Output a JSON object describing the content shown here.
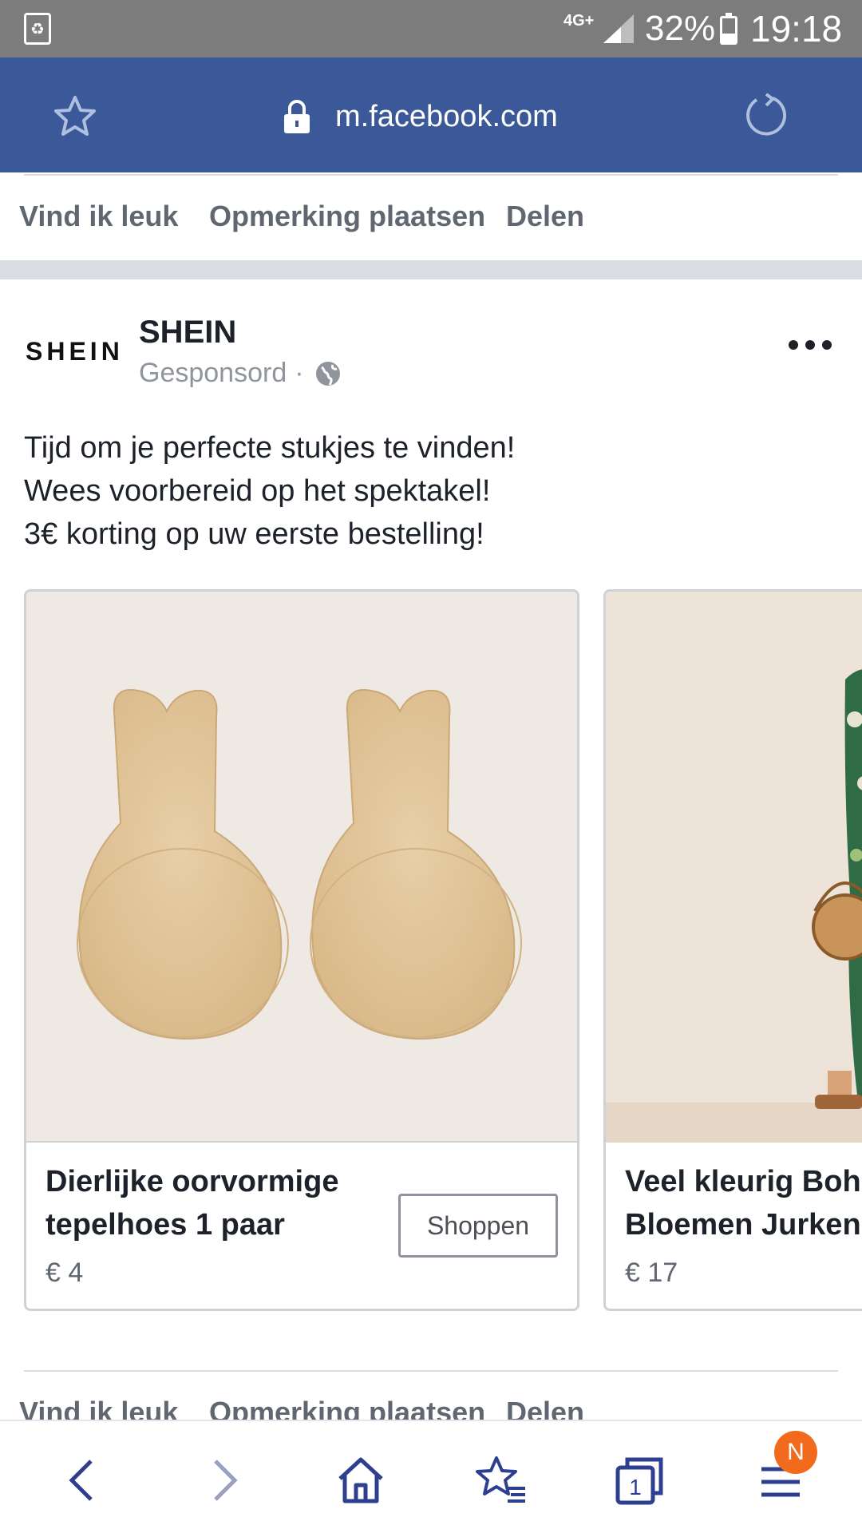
{
  "status_bar": {
    "network": "4G+",
    "battery_percent": "32%",
    "battery_level": 0.32,
    "time": "19:18",
    "icons": [
      "recycle-icon",
      "signal-icon",
      "battery-icon"
    ]
  },
  "browser": {
    "url": "m.facebook.com",
    "icons": [
      "star-icon",
      "lock-icon",
      "reload-icon"
    ]
  },
  "post_actions_top": {
    "like": "Vind ik leuk",
    "comment": "Opmerking plaatsen",
    "share": "Delen"
  },
  "post": {
    "brand_logo": "SHEIN",
    "page_name": "SHEIN",
    "sponsored": "Gesponsord",
    "separator": "·",
    "text_lines": [
      "Tijd om je perfecte stukjes te vinden!",
      "Wees voorbereid op het spektakel!",
      "3€ korting op uw eerste bestelling!"
    ]
  },
  "carousel": [
    {
      "title_line1": "Dierlijke oorvormige",
      "title_line2": "tepelhoes 1 paar",
      "price": "€ 4",
      "button": "Shoppen"
    },
    {
      "title_line1": "Veel kleurig Boh",
      "title_line2": "Bloemen Jurken",
      "price": "€ 17"
    }
  ],
  "post_actions_bottom": {
    "like": "Vind ik leuk",
    "comment": "Opmerking plaatsen",
    "share": "Delen"
  },
  "bottom_nav": {
    "icons": [
      "back-icon",
      "forward-icon",
      "home-icon",
      "bookmarks-icon",
      "tabs-icon",
      "menu-icon"
    ],
    "tabs_count": "1",
    "menu_badge": "N"
  },
  "colors": {
    "facebook_blue": "#3b5998",
    "status_bar": "#7c7c7c",
    "badge": "#f26b1d",
    "product_tan": "#e4c79c"
  }
}
